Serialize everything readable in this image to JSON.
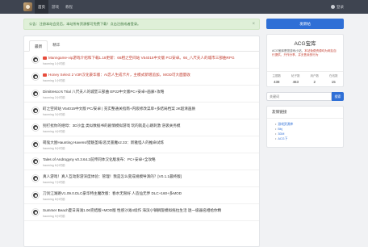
{
  "nav": {
    "items": [
      {
        "label": "首页",
        "active": true
      },
      {
        "label": "游戏",
        "active": false
      },
      {
        "label": "教程",
        "active": false
      }
    ],
    "login": "登录"
  },
  "notice": {
    "text": "公告：注册本站会员后，本站所有资源都可免费下载！点击注册成者登录。",
    "close": "×"
  },
  "tabs": [
    {
      "label": "最新",
      "active": true
    },
    {
      "label": "精华",
      "active": false
    }
  ],
  "threads": [
    {
      "title": "Manngame-vip游戏介绍和下载1.18更新：66相之空间站 V54015中文版 PC/安卓。66_八尺夫人的城市三部曲RPG",
      "meta": "haoming 1小时前",
      "pinned": true
    },
    {
      "title": "Honey Select 2 V3R汉化豪华版：AI恋人生成卡片，主模式新增追加，MOD可大面量收",
      "meta": "haoming 1小时前",
      "pinned": true
    },
    {
      "title": "Dimitresco's Trial 八尺夫人的城堡三部曲 EP22中文版PC+安卓+画廊+攻略",
      "meta": "haoming 2小时前",
      "pinned": false
    },
    {
      "title": "町之空间站 V54015中文版 PC/安卓 | 充实整通关指南+内嵌修改菜单+多结局档案 2K超清画质",
      "meta": "haoming 3小时前",
      "pinned": false
    },
    {
      "title": "别打扰你的继母：3D沙盒 类似数据书的剧情模拟游戏 玩的就是心跳刺激 逆袭关务模",
      "meta": "haoming 4小时前",
      "pinned": false
    },
    {
      "title": "萌鬼大屋Haunting Havens/猎魅圣域/恶灵噩魔v2.33：新雅怪人的推命试炼",
      "meta": "haoming 5小时前",
      "pinned": false
    },
    {
      "title": "Tales of Androgyny v0.3.64.2前传同体汉化版发布：PC+安卓+全攻略",
      "meta": "haoming 6小时前",
      "pinned": false
    },
    {
      "title": "真人游戏！真人互动影游深度体验：管理！我是怎么变成规模导演的？[V0.1.1最终版]",
      "meta": "haoming 7小时前",
      "pinned": false
    },
    {
      "title": "刀剑江湖路V1.09.0.DLC豪华特主魔改版：春水无限好 人造仙无界 DLC+160+多MOD",
      "meta": "haoming 8小时前",
      "pinned": false
    },
    {
      "title": "Summer Beach夏日海滩1.06完结版+MOD版 性感沙滩4续作 海滨小镇狮旋模拟拖拉生活 迷一级器名相给你精",
      "meta": "haoming 9小时前",
      "pinned": false
    }
  ],
  "sidebar": {
    "post_button": "发新帖",
    "site": {
      "name": "ACG宝库",
      "desc_normal": "ACG宝库是您游戏小站，",
      "desc_warn": "本站免费资源均为网友自行提供，只作分享，并无售卖的行为",
      "stats": [
        {
          "label": "主题数",
          "value": "438"
        },
        {
          "label": "帖子数",
          "value": "463"
        },
        {
          "label": "用户数",
          "value": "2"
        },
        {
          "label": "在线数",
          "value": "15"
        }
      ]
    },
    "search": {
      "placeholder": "关键词",
      "button": "搜索"
    },
    "links": {
      "title": "友情链接",
      "items": [
        "游戏资源库",
        "Bbj",
        "3DM",
        "ACG下"
      ]
    }
  }
}
